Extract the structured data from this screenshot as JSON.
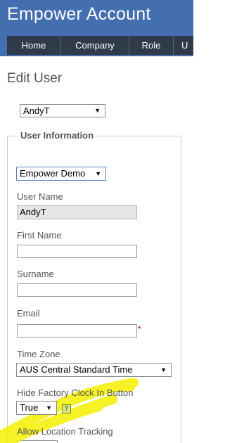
{
  "app": {
    "title": "Empower Account"
  },
  "nav": {
    "items": [
      {
        "label": "Home"
      },
      {
        "label": "Company"
      },
      {
        "label": "Role"
      },
      {
        "label": "U"
      }
    ]
  },
  "page": {
    "title": "Edit User"
  },
  "user_select": {
    "value": "AndyT"
  },
  "user_info": {
    "legend": "User Information",
    "company_select": {
      "value": "Empower Demo"
    },
    "username": {
      "label": "User Name",
      "value": "AndyT"
    },
    "first_name": {
      "label": "First Name",
      "value": ""
    },
    "surname": {
      "label": "Surname",
      "value": ""
    },
    "email": {
      "label": "Email",
      "value": "",
      "required_marker": "*"
    },
    "time_zone": {
      "label": "Time Zone",
      "value": "AUS Central Standard Time"
    },
    "hide_factory_clock": {
      "label": "Hide Factory Clock In Button",
      "value": "True",
      "help": "?"
    },
    "allow_location": {
      "label": "Allow Location Tracking"
    }
  },
  "icons": {
    "dropdown": "▼"
  },
  "colors": {
    "header_bg": "#436eb0",
    "nav_bg": "#2f3b49",
    "highlight": "#f5f000",
    "required": "#cc0000"
  }
}
